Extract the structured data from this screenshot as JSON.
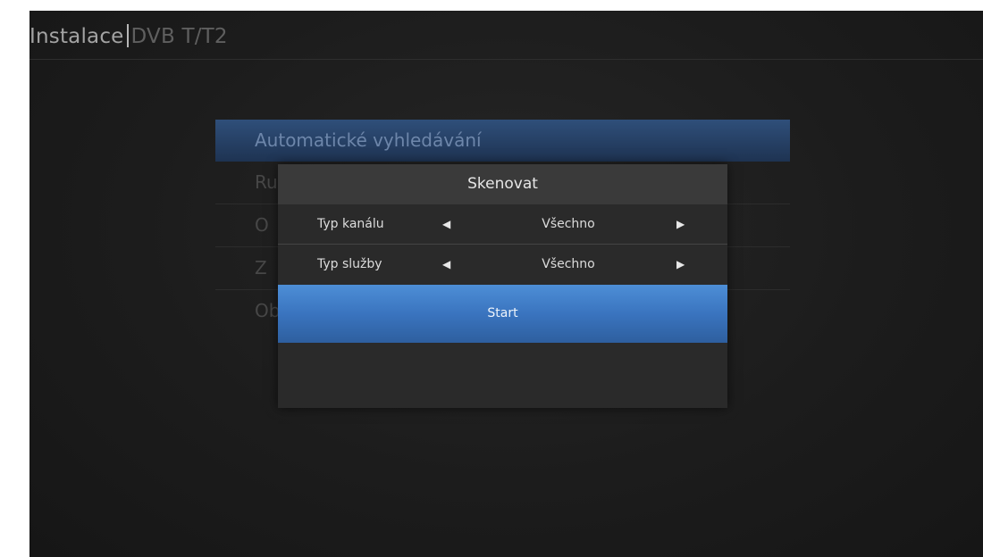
{
  "header": {
    "title": "Instalace",
    "subtitle": "DVB T/T2"
  },
  "menu": {
    "items": [
      {
        "label": "Automatické vyhledávání",
        "selected": true
      },
      {
        "label": "Ru",
        "selected": false
      },
      {
        "label": "O",
        "selected": false
      },
      {
        "label": "Z",
        "selected": false
      },
      {
        "label": "Ob",
        "selected": false
      }
    ]
  },
  "dialog": {
    "title": "Skenovat",
    "options": [
      {
        "label": "Typ kanálu",
        "value": "Všechno"
      },
      {
        "label": "Typ služby",
        "value": "Všechno"
      }
    ],
    "start_label": "Start"
  },
  "icons": {
    "left_arrow": "left-arrow-icon",
    "right_arrow": "right-arrow-icon"
  },
  "colors": {
    "accent": "#3a74bf",
    "selected_row": "#2f4f7a"
  }
}
